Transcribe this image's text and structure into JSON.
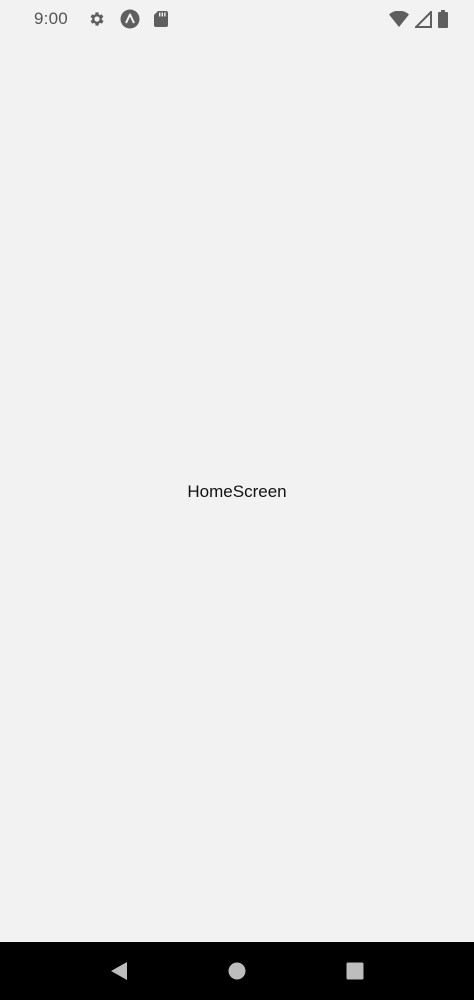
{
  "status_bar": {
    "time": "9:00",
    "left_icons": [
      "settings-icon",
      "app-notification-icon",
      "sd-card-icon"
    ],
    "right_icons": [
      "wifi-icon",
      "cell-signal-icon",
      "battery-icon"
    ],
    "icon_color": "#5f5f5f"
  },
  "main": {
    "title": "HomeScreen"
  },
  "nav_bar": {
    "background": "#000000",
    "buttons": [
      "back-button",
      "home-button",
      "recents-button"
    ],
    "button_color": "#bdbdbd"
  }
}
